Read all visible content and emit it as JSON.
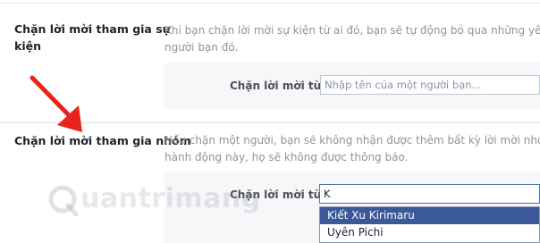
{
  "colors": {
    "annotation_arrow": "#e8231b",
    "selected_bg": "#3b5998",
    "panel_bg": "#f6f7f9"
  },
  "event_block": {
    "title_line1": "Chặn lời mời tham gia sự",
    "title_line2": "kiện",
    "desc_line1": "Khi bạn chặn lời mời sự kiện từ ai đó, bạn sẽ tự động bỏ qua những yêu cầu s",
    "desc_line2": "người bạn đó.",
    "field_label": "Chặn lời mời từ",
    "field_placeholder": "Nhập tên của một người bạn..."
  },
  "group_block": {
    "title": "Chặn lời mời tham gia nhóm",
    "desc_line1": "Nếu chặn một người, bạn sẽ không nhận được thêm bất kỳ lời mời nhóm nào",
    "desc_line2": "hành động này, họ sẽ không được thông báo.",
    "field_label": "Chặn lời mời từ",
    "field_value": "K"
  },
  "suggestions": [
    {
      "label": "Kiết Xu Kirimaru",
      "selected": true
    },
    {
      "label": "Uyên Pichi",
      "selected": false
    }
  ],
  "watermark": {
    "text": "uantrimang",
    "icon": "quantrimang-logo-icon"
  },
  "annotation": {
    "icon": "red-arrow-icon"
  }
}
